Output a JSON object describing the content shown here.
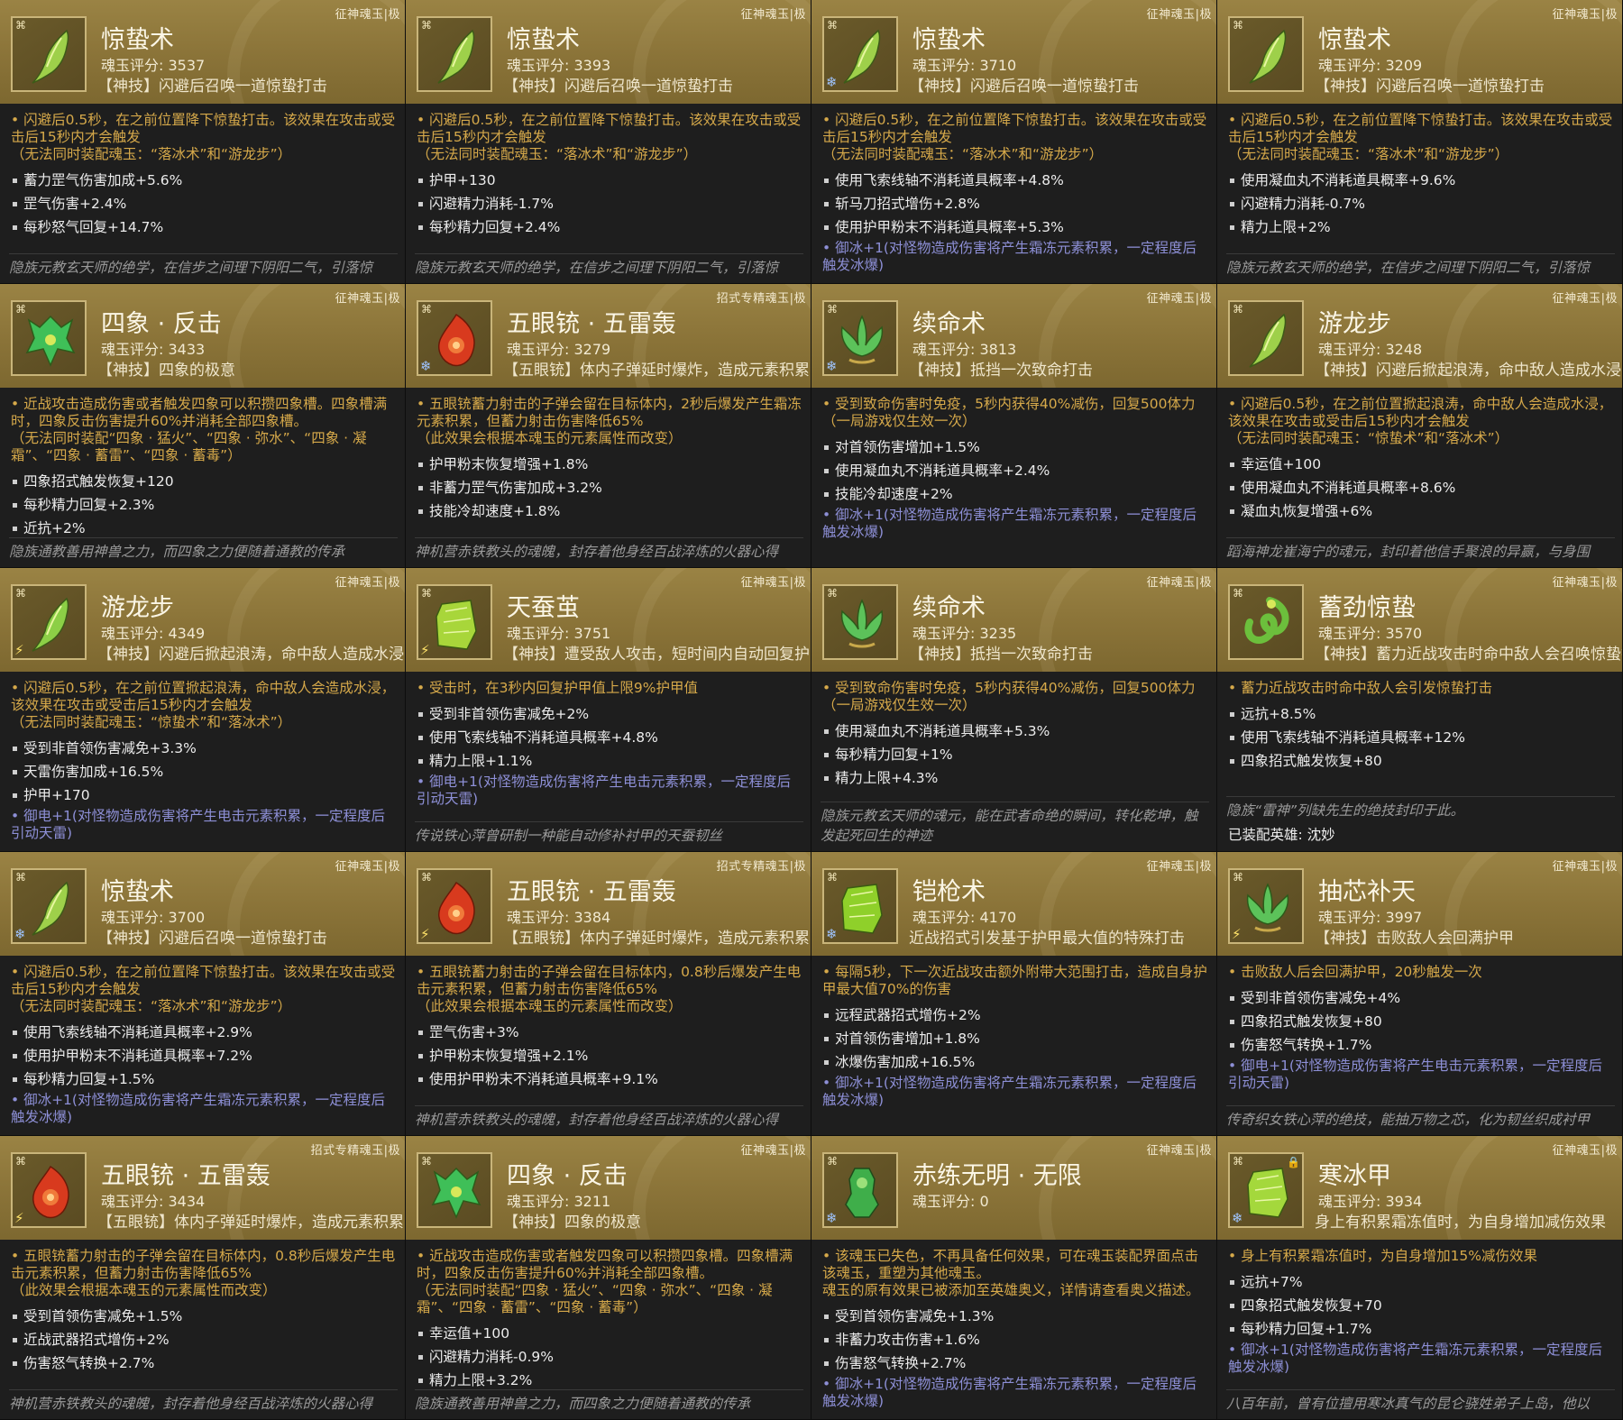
{
  "grade_labels": {
    "zhengshen": "征神魂玉|极",
    "zhaoshi": "招式专精魂玉|极"
  },
  "cards": [
    {
      "grade": "征神魂玉|极",
      "title": "惊蛰术",
      "score": "魂玉评分: 3537",
      "skill": "【神技】闪避后召唤一道惊蛰打击",
      "icon": "spear-tip-icon",
      "gem_color": "#9ed04a",
      "element": "",
      "desc": "• 闪避后0.5秒，在之前位置降下惊蛰打击。该效果在攻击或受击后15秒内才会触发\n（无法同时装配魂玉：“落冰术”和“游龙步”）",
      "stats": [
        "蓄力罡气伤害加成+5.6%",
        "罡气伤害+2.4%",
        "每秒怒气回复+14.7%"
      ],
      "extra": "",
      "lore": "隐族元教玄天师的绝学，在信步之间理下阴阳二气，引落惊"
    },
    {
      "grade": "征神魂玉|极",
      "title": "惊蛰术",
      "score": "魂玉评分: 3393",
      "skill": "【神技】闪避后召唤一道惊蛰打击",
      "icon": "spear-tip-icon",
      "gem_color": "#9ed04a",
      "element": "",
      "desc": "• 闪避后0.5秒，在之前位置降下惊蛰打击。该效果在攻击或受击后15秒内才会触发\n（无法同时装配魂玉：“落冰术”和“游龙步”）",
      "stats": [
        "护甲+130",
        "闪避精力消耗-1.7%",
        "每秒精力回复+2.4%"
      ],
      "extra": "",
      "lore": "隐族元教玄天师的绝学，在信步之间理下阴阳二气，引落惊"
    },
    {
      "grade": "征神魂玉|极",
      "title": "惊蛰术",
      "score": "魂玉评分: 3710",
      "skill": "【神技】闪避后召唤一道惊蛰打击",
      "icon": "spear-tip-icon",
      "gem_color": "#9ed04a",
      "element": "ice",
      "desc": "• 闪避后0.5秒，在之前位置降下惊蛰打击。该效果在攻击或受击后15秒内才会触发\n（无法同时装配魂玉：“落冰术”和“游龙步”）",
      "stats": [
        "使用飞索线轴不消耗道具概率+4.8%",
        "斩马刀招式增伤+2.8%",
        "使用护甲粉末不消耗道具概率+5.3%"
      ],
      "extra": "• 御冰+1(对怪物造成伤害将产生霜冻元素积累，一定程度后触发冰爆)",
      "lore": ""
    },
    {
      "grade": "征神魂玉|极",
      "title": "惊蛰术",
      "score": "魂玉评分: 3209",
      "skill": "【神技】闪避后召唤一道惊蛰打击",
      "icon": "spear-tip-icon",
      "gem_color": "#9ed04a",
      "element": "",
      "desc": "• 闪避后0.5秒，在之前位置降下惊蛰打击。该效果在攻击或受击后15秒内才会触发\n（无法同时装配魂玉：“落冰术”和“游龙步”）",
      "stats": [
        "使用凝血丸不消耗道具概率+9.6%",
        "闪避精力消耗-0.7%",
        "精力上限+2%"
      ],
      "extra": "",
      "lore": "隐族元教玄天师的绝学，在信步之间理下阴阳二气，引落惊"
    },
    {
      "grade": "征神魂玉|极",
      "title": "四象 · 反击",
      "score": "魂玉评分: 3433",
      "skill": "【神技】四象的极意",
      "icon": "four-symbols-icon",
      "gem_color": "#3fbf58",
      "element": "",
      "desc": "• 近战攻击造成伤害或者触发四象可以积攒四象槽。四象槽满时，四象反击伤害提升60%并消耗全部四象槽。\n（无法同时装配“四象 · 猛火”、“四象 · 弥水”、“四象 · 凝霜”、“四象 · 蓄雷”、“四象 · 蓄毒”）",
      "stats": [
        "四象招式触发恢复+120",
        "每秒精力回复+2.3%",
        "近抗+2%"
      ],
      "extra": "",
      "lore": "隐族通教善用神兽之力，而四象之力便随着通教的传承"
    },
    {
      "grade": "招式专精魂玉|极",
      "title": "五眼铳 · 五雷轰",
      "score": "魂玉评分: 3279",
      "skill": "【五眼铳】体内子弹延时爆炸，造成元素积累",
      "icon": "flame-orb-icon",
      "gem_color": "#d83a1e",
      "element": "ice",
      "desc": "• 五眼铳蓄力射击的子弹会留在目标体内，2秒后爆发产生霜冻元素积累，但蓄力射击伤害降低65%\n（此效果会根据本魂玉的元素属性而改变）",
      "stats": [
        "护甲粉末恢复增强+1.8%",
        "非蓄力罡气伤害加成+3.2%",
        "技能冷却速度+1.8%"
      ],
      "extra": "",
      "lore": "神机营赤铁教头的魂魄，封存着他身经百战淬炼的火器心得"
    },
    {
      "grade": "征神魂玉|极",
      "title": "续命术",
      "score": "魂玉评分: 3813",
      "skill": "【神技】抵挡一次致命打击",
      "icon": "lotus-icon",
      "gem_color": "#5cc25a",
      "element": "ice",
      "desc": "• 受到致命伤害时免疫，5秒内获得40%减伤，回复500体力\n（一局游戏仅生效一次）",
      "stats": [
        "对首领伤害增加+1.5%",
        "使用凝血丸不消耗道具概率+2.4%",
        "技能冷却速度+2%"
      ],
      "extra": "• 御冰+1(对怪物造成伤害将产生霜冻元素积累，一定程度后触发冰爆)",
      "lore": ""
    },
    {
      "grade": "征神魂玉|极",
      "title": "游龙步",
      "score": "魂玉评分: 3248",
      "skill": "【神技】闪避后掀起浪涛，命中敌人造成水浸",
      "icon": "spear-tip-icon",
      "gem_color": "#9ed04a",
      "element": "",
      "desc": "• 闪避后0.5秒，在之前位置掀起浪涛，命中敌人会造成水浸，该效果在攻击或受击后15秒内才会触发\n（无法同时装配魂玉：“惊蛰术”和“落冰术”）",
      "stats": [
        "幸运值+100",
        "使用凝血丸不消耗道具概率+8.6%",
        "凝血丸恢复增强+6%"
      ],
      "extra": "",
      "lore": "蹈海神龙崔海宁的魂元，封印着他信手聚浪的异赢，与身围"
    },
    {
      "grade": "征神魂玉|极",
      "title": "游龙步",
      "score": "魂玉评分: 4349",
      "skill": "【神技】闪避后掀起浪涛，命中敌人造成水浸",
      "icon": "spear-tip-icon",
      "gem_color": "#8ccf46",
      "element": "elec",
      "desc": "• 闪避后0.5秒，在之前位置掀起浪涛，命中敌人会造成水浸，该效果在攻击或受击后15秒内才会触发\n（无法同时装配魂玉：“惊蛰术”和“落冰术”）",
      "stats": [
        "受到非首领伤害减免+3.3%",
        "天雷伤害加成+16.5%",
        "护甲+170"
      ],
      "extra": "• 御电+1(对怪物造成伤害将产生电击元素积累，一定程度后引动天雷)",
      "lore": ""
    },
    {
      "grade": "征神魂玉|极",
      "title": "天蚕茧",
      "score": "魂玉评分: 3751",
      "skill": "【神技】遭受敌人攻击，短时间内自动回复护甲值",
      "icon": "silk-scroll-icon",
      "gem_color": "#a8d63a",
      "element": "elec",
      "desc": "• 受击时，在3秒内回复护甲值上限9%护甲值",
      "stats": [
        "受到非首领伤害减免+2%",
        "使用飞索线轴不消耗道具概率+4.8%",
        "精力上限+1.1%"
      ],
      "extra": "• 御电+1(对怪物造成伤害将产生电击元素积累，一定程度后引动天雷)",
      "lore": "传说铁心萍曾研制一种能自动修补衬甲的天蚕韧丝"
    },
    {
      "grade": "征神魂玉|极",
      "title": "续命术",
      "score": "魂玉评分: 3235",
      "skill": "【神技】抵挡一次致命打击",
      "icon": "lotus-icon",
      "gem_color": "#5cc25a",
      "element": "",
      "desc": "• 受到致命伤害时免疫，5秒内获得40%减伤，回复500体力\n（一局游戏仅生效一次）",
      "stats": [
        "使用凝血丸不消耗道具概率+5.3%",
        "每秒精力回复+1%",
        "精力上限+4.3%"
      ],
      "extra": "",
      "lore": "隐族元教玄天师的魂元，能在武者命绝的瞬间，转化乾坤，触发起死回生的神迹"
    },
    {
      "grade": "征神魂玉|极",
      "title": "蓄劲惊蛰",
      "score": "魂玉评分: 3570",
      "skill": "【神技】蓄力近战攻击时命中敌人会召唤惊蛰打击",
      "icon": "coiled-dragon-icon",
      "gem_color": "#6cbf3c",
      "element": "",
      "desc": "• 蓄力近战攻击时命中敌人会引发惊蛰打击",
      "stats": [
        "远抗+8.5%",
        "使用飞索线轴不消耗道具概率+12%",
        "四象招式触发恢复+80"
      ],
      "extra": "",
      "lore": "隐族“雷神”列缺先生的绝技封印于此。",
      "equipped": "已装配英雄: 沈妙"
    },
    {
      "grade": "征神魂玉|极",
      "title": "惊蛰术",
      "score": "魂玉评分: 3700",
      "skill": "【神技】闪避后召唤一道惊蛰打击",
      "icon": "spear-tip-icon",
      "gem_color": "#9ed04a",
      "element": "ice",
      "desc": "• 闪避后0.5秒，在之前位置降下惊蛰打击。该效果在攻击或受击后15秒内才会触发\n（无法同时装配魂玉：“落冰术”和“游龙步”）",
      "stats": [
        "使用飞索线轴不消耗道具概率+2.9%",
        "使用护甲粉末不消耗道具概率+7.2%",
        "每秒精力回复+1.5%"
      ],
      "extra": "• 御冰+1(对怪物造成伤害将产生霜冻元素积累，一定程度后触发冰爆)",
      "lore": ""
    },
    {
      "grade": "招式专精魂玉|极",
      "title": "五眼铳 · 五雷轰",
      "score": "魂玉评分: 3384",
      "skill": "【五眼铳】体内子弹延时爆炸，造成元素积累",
      "icon": "flame-orb-icon",
      "gem_color": "#d83a1e",
      "element": "elec",
      "desc": "• 五眼铳蓄力射击的子弹会留在目标体内，0.8秒后爆发产生电击元素积累，但蓄力射击伤害降低65%\n（此效果会根据本魂玉的元素属性而改变）",
      "stats": [
        "罡气伤害+3%",
        "护甲粉末恢复增强+2.1%",
        "使用护甲粉末不消耗道具概率+9.1%"
      ],
      "extra": "",
      "lore": "神机营赤铁教头的魂魄，封存着他身经百战淬炼的火器心得"
    },
    {
      "grade": "征神魂玉|极",
      "title": "铠枪术",
      "score": "魂玉评分: 4170",
      "skill": "近战招式引发基于护甲最大值的特殊打击",
      "icon": "armor-shard-icon",
      "gem_color": "#8fd02a",
      "element": "ice",
      "desc": "• 每隔5秒，下一次近战攻击额外附带大范围打击，造成自身护甲最大值70%的伤害",
      "stats": [
        "远程武器招式增伤+2%",
        "对首领伤害增加+1.8%",
        "冰爆伤害加成+16.5%"
      ],
      "extra": "• 御冰+1(对怪物造成伤害将产生霜冻元素积累，一定程度后触发冰爆)",
      "lore": ""
    },
    {
      "grade": "征神魂玉|极",
      "title": "抽芯补天",
      "score": "魂玉评分: 3997",
      "skill": "【神技】击败敌人会回满护甲",
      "icon": "lotus-icon",
      "gem_color": "#5cc25a",
      "element": "elec",
      "desc": "• 击败敌人后会回满护甲，20秒触发一次",
      "stats": [
        "受到非首领伤害减免+4%",
        "四象招式触发恢复+80",
        "伤害怒气转换+1.7%"
      ],
      "extra": "• 御电+1(对怪物造成伤害将产生电击元素积累，一定程度后引动天雷)",
      "lore": "传奇织女铁心萍的绝技，能抽万物之芯，化为韧丝织成衬甲"
    },
    {
      "grade": "招式专精魂玉|极",
      "title": "五眼铳 · 五雷轰",
      "score": "魂玉评分: 3434",
      "skill": "【五眼铳】体内子弹延时爆炸，造成元素积累",
      "icon": "flame-orb-icon",
      "gem_color": "#d83a1e",
      "element": "elec",
      "desc": "• 五眼铳蓄力射击的子弹会留在目标体内，0.8秒后爆发产生电击元素积累，但蓄力射击伤害降低65%\n（此效果会根据本魂玉的元素属性而改变）",
      "stats": [
        "受到首领伤害减免+1.5%",
        "近战武器招式增伤+2%",
        "伤害怒气转换+2.7%"
      ],
      "extra": "",
      "lore": "神机营赤铁教头的魂魄，封存着他身经百战淬炼的火器心得"
    },
    {
      "grade": "征神魂玉|极",
      "title": "四象 · 反击",
      "score": "魂玉评分: 3211",
      "skill": "【神技】四象的极意",
      "icon": "four-symbols-icon",
      "gem_color": "#3fbf58",
      "element": "",
      "desc": "• 近战攻击造成伤害或者触发四象可以积攒四象槽。四象槽满时，四象反击伤害提升60%并消耗全部四象槽。\n（无法同时装配“四象 · 猛火”、“四象 · 弥水”、“四象 · 凝霜”、“四象 · 蓄雷”、“四象 · 蓄毒”）",
      "stats": [
        "幸运值+100",
        "闪避精力消耗-0.9%",
        "精力上限+3.2%"
      ],
      "extra": "",
      "lore": "隐族通教善用神兽之力，而四象之力便随着通教的传承"
    },
    {
      "grade": "征神魂玉|极",
      "title": "赤练无明 · 无限",
      "score": "魂玉评分: 0",
      "skill": "",
      "icon": "jade-idol-icon",
      "gem_color": "#3fae4a",
      "element": "ice",
      "desc": "• 该魂玉已失色，不再具备任何效果，可在魂玉装配界面点击该魂玉，重塑为其他魂玉。\n魂玉的原有效果已被添加至英雄奥义，详情请查看奥义描述。",
      "stats": [
        "受到首领伤害减免+1.3%",
        "非蓄力攻击伤害+1.6%",
        "伤害怒气转换+2.7%"
      ],
      "extra": "• 御冰+1(对怪物造成伤害将产生霜冻元素积累，一定程度后触发冰爆)",
      "lore": ""
    },
    {
      "grade": "征神魂玉|极",
      "title": "寒冰甲",
      "score": "魂玉评分: 3934",
      "skill": "身上有积累霜冻值时，为自身增加减伤效果",
      "icon": "armor-shard-icon",
      "gem_color": "#a4d83c",
      "element": "ice",
      "locked": true,
      "desc": "• 身上有积累霜冻值时，为自身增加15%减伤效果",
      "stats": [
        "远抗+7%",
        "四象招式触发恢复+70",
        "每秒精力回复+1.7%"
      ],
      "extra": "• 御冰+1(对怪物造成伤害将产生霜冻元素积累，一定程度后触发冰爆)",
      "lore": "八百年前，曾有位擅用寒冰真气的昆仑骁姓弟子上岛，他以"
    }
  ]
}
